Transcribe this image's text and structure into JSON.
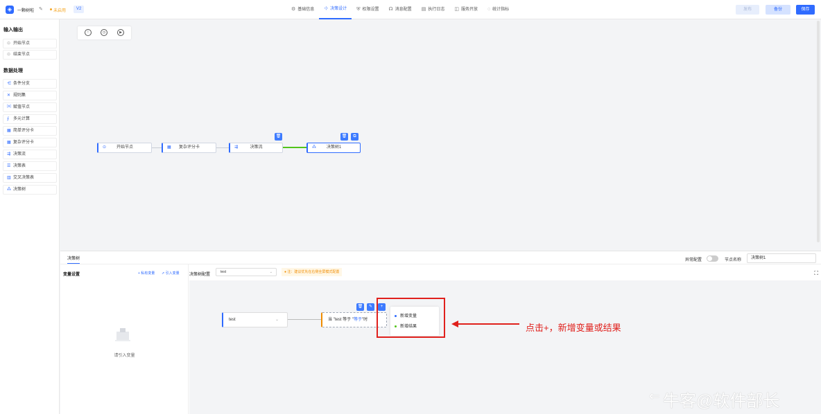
{
  "header": {
    "title": "一颗树啦",
    "status": "未启用",
    "version": "V2",
    "tabs": [
      {
        "icon": "⚙",
        "label": "基础信息",
        "active": false
      },
      {
        "icon": "⊹",
        "label": "决策设计",
        "active": true
      },
      {
        "icon": "⛨",
        "label": "权限设置",
        "active": false
      },
      {
        "icon": "☊",
        "label": "消息配置",
        "active": false
      },
      {
        "icon": "▤",
        "label": "执行日志",
        "active": false
      },
      {
        "icon": "◫",
        "label": "服务开放",
        "active": false
      },
      {
        "icon": "◌",
        "label": "统计指标",
        "active": false
      }
    ],
    "buttons": {
      "publish": "发布",
      "backup": "备份",
      "save": "保存"
    }
  },
  "sidebar": {
    "groups": [
      {
        "title": "输入输出",
        "items": [
          {
            "icon": "⊙",
            "label": "开始节点"
          },
          {
            "icon": "⊙",
            "label": "结束节点"
          }
        ]
      },
      {
        "title": "数据处理",
        "items": [
          {
            "icon": "⋲",
            "label": "条件分支"
          },
          {
            "icon": "✕",
            "label": "规则集"
          },
          {
            "icon": "⒳",
            "label": "赋值节点"
          },
          {
            "icon": "⨍",
            "label": "多元计算"
          },
          {
            "icon": "▦",
            "label": "简单评分卡"
          },
          {
            "icon": "▦",
            "label": "复杂评分卡"
          },
          {
            "icon": "⇶",
            "label": "决策流"
          },
          {
            "icon": "☰",
            "label": "决策表"
          },
          {
            "icon": "▥",
            "label": "交叉决策表"
          },
          {
            "icon": "⁂",
            "label": "决策树"
          }
        ]
      }
    ]
  },
  "canvas": {
    "controls": [
      "!",
      "◷",
      "▶"
    ],
    "nodes": [
      {
        "icon": "⊙",
        "label": "开始节点"
      },
      {
        "icon": "▦",
        "label": "复杂评分卡"
      },
      {
        "icon": "⇶",
        "label": "决策流"
      },
      {
        "icon": "⁂",
        "label": "决策树1"
      }
    ]
  },
  "bottom": {
    "tab": "决策树",
    "exception_label": "异常配置",
    "node_name_label": "节点名称",
    "node_name_value": "决策树1",
    "var_title": "变量设置",
    "private_var": "+ 私有变量",
    "import_var": "⇗ 引入变量",
    "empty_text": "请引入变量",
    "tree_config_label": "决策树配置",
    "tree_select": "test",
    "tip": "注：建议优先在右侧全屏模式配置",
    "tree_node_1": "test",
    "tree_node_2_prefix": "当 \"test 等于 \"",
    "tree_node_2_highlight": "等于",
    "tree_node_2_suffix": "\"时",
    "popup": [
      {
        "label": "新增变量",
        "color": "#2f6bff"
      },
      {
        "label": "新增结果",
        "color": "#52c41a"
      }
    ]
  },
  "annotation": "点击+，新增变量或结果",
  "watermark": "牛客@软件部长"
}
